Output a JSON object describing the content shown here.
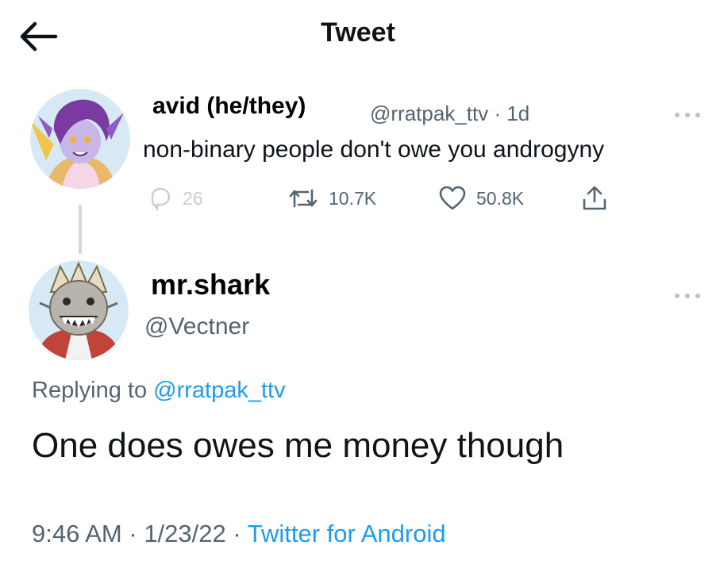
{
  "header": {
    "title": "Tweet",
    "back_icon": "arrow-left-icon"
  },
  "parent_tweet": {
    "display_name": "avid (he/they)",
    "handle": "@rratpak_ttv",
    "separator": " · ",
    "age": "1d",
    "text": "non-binary people don't owe you androgyny",
    "stats": {
      "replies": "26",
      "retweets": "10.7K",
      "likes": "50.8K"
    },
    "avatar_icon": "purple-hair-character-avatar"
  },
  "reply_tweet": {
    "display_name": "mr.shark",
    "handle": "@Vectner",
    "replying_prefix": "Replying to ",
    "replying_to": "@rratpak_ttv",
    "text": "One does owes me money though",
    "time": "9:46 AM",
    "date": "1/23/22",
    "separator": " · ",
    "source": "Twitter for Android",
    "avatar_icon": "shark-mask-character-avatar"
  },
  "colors": {
    "accent": "#1d9bf0",
    "muted_text": "#536471",
    "primary_text": "#0f1419",
    "thread_line": "#cfd9de"
  }
}
